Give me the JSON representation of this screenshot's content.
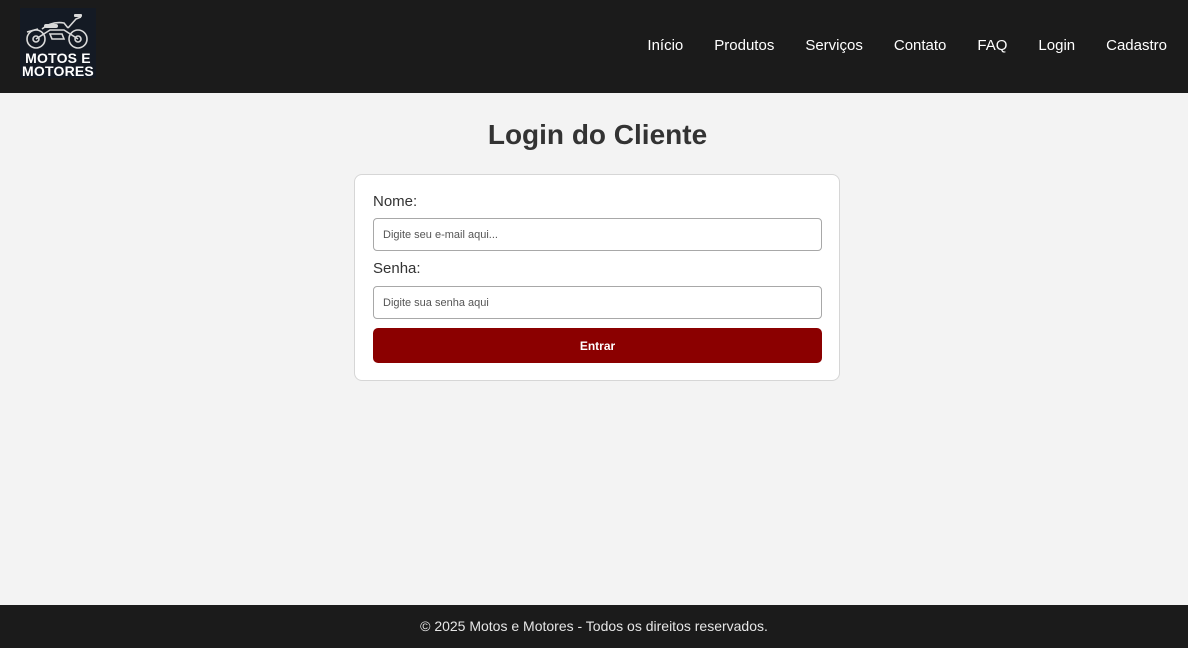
{
  "header": {
    "logo": {
      "line1": "MOTOS E",
      "line2": "MOTORES",
      "icon": "motorcycle-icon"
    },
    "nav": [
      {
        "label": "Início"
      },
      {
        "label": "Produtos"
      },
      {
        "label": "Serviços"
      },
      {
        "label": "Contato"
      },
      {
        "label": "FAQ"
      },
      {
        "label": "Login"
      },
      {
        "label": "Cadastro"
      }
    ]
  },
  "main": {
    "title": "Login do Cliente",
    "form": {
      "name_label": "Nome:",
      "name_placeholder": "Digite seu e-mail aqui...",
      "name_value": "",
      "password_label": "Senha:",
      "password_placeholder": "Digite sua senha aqui",
      "password_value": "",
      "submit_label": "Entrar"
    }
  },
  "footer": {
    "text": "© 2025 Motos e Motores - Todos os direitos reservados."
  },
  "colors": {
    "header_bg": "#1b1b1b",
    "page_bg": "#f3f3f3",
    "button_bg": "#8b0000",
    "text_dark": "#333333"
  }
}
